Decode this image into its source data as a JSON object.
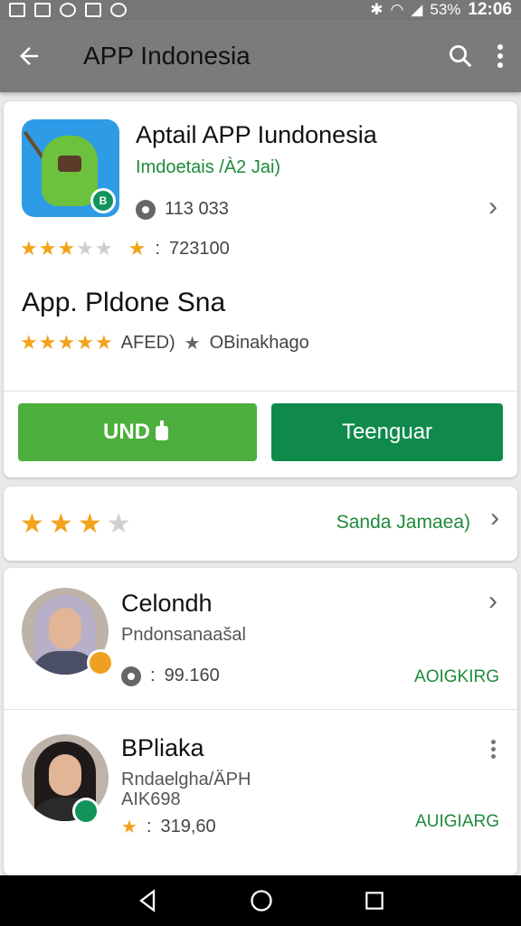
{
  "status_bar": {
    "battery": "53%",
    "time": "12:06"
  },
  "app_bar": {
    "title": "APP Indonesia"
  },
  "app_card": {
    "title": "Aptail APP Iundonesia",
    "subtitle": "Imdoetais /À2 Jai)",
    "downloads": "113 033",
    "rating_count": "723100",
    "section_title": "App. Pldone Sna",
    "section_meta": "AFED)",
    "section_category": "OBinakhago",
    "install_label": "UND",
    "open_label": "Teenguar"
  },
  "rating_card": {
    "link": "Sanda Jamaea)"
  },
  "people": [
    {
      "name": "Celondh",
      "sub": "Pndonsanaašal",
      "count": "99.160",
      "tag": "AOIGKIRG"
    },
    {
      "name": "BPliaka",
      "sub": "Rndaelgha/ÄPH",
      "sub2": "AIK698",
      "count": "319,60",
      "tag": "AUIGIARG"
    }
  ],
  "colors": {
    "accent_green": "#1f8a3a",
    "install_green": "#4cae3c",
    "open_green": "#0f8a4c",
    "star": "#f2a31b"
  }
}
